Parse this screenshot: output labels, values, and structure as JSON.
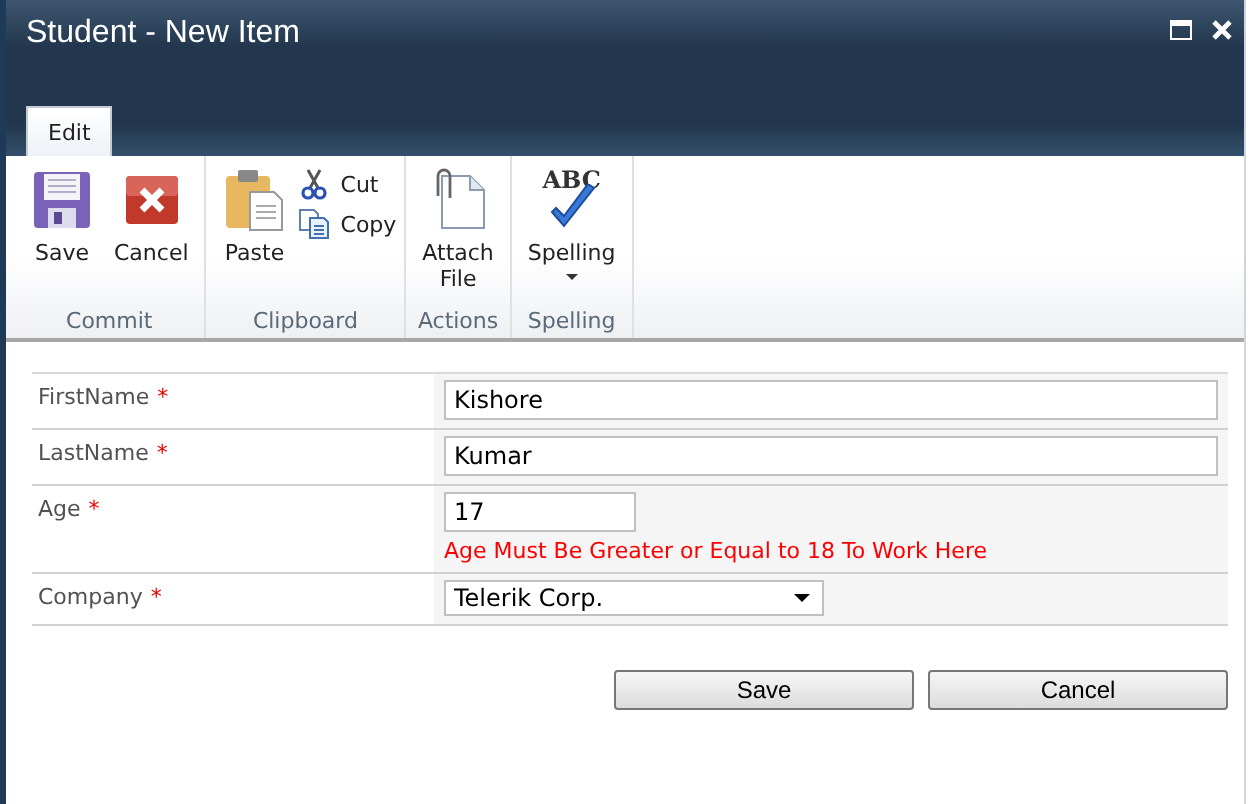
{
  "window": {
    "title": "Student - New Item"
  },
  "tabs": [
    {
      "label": "Edit",
      "selected": true
    }
  ],
  "ribbon_groups": [
    {
      "label": "Commit",
      "items": [
        {
          "kind": "large",
          "label": "Save"
        },
        {
          "kind": "large",
          "label": "Cancel"
        }
      ]
    },
    {
      "label": "Clipboard",
      "items": [
        {
          "kind": "large",
          "label": "Paste"
        },
        {
          "kind": "small",
          "label": "Cut"
        },
        {
          "kind": "small",
          "label": "Copy"
        }
      ]
    },
    {
      "label": "Actions",
      "items": [
        {
          "kind": "large",
          "label": "Attach File"
        }
      ]
    },
    {
      "label": "Spelling",
      "items": [
        {
          "kind": "large",
          "icon_text": "ABC",
          "label": "Spelling",
          "dropdown": true
        }
      ]
    }
  ],
  "fields": [
    {
      "label": "FirstName",
      "required": "*",
      "kind": "text",
      "value": "Kishore"
    },
    {
      "label": "LastName",
      "required": "*",
      "kind": "text",
      "value": "Kumar"
    },
    {
      "label": "Age",
      "required": "*",
      "kind": "short",
      "value": "17",
      "error": "Age Must Be Greater or Equal to 18 To Work Here"
    },
    {
      "label": "Company",
      "required": "*",
      "kind": "select",
      "value": "Telerik Corp."
    }
  ],
  "buttons": [
    "Save",
    "Cancel"
  ]
}
